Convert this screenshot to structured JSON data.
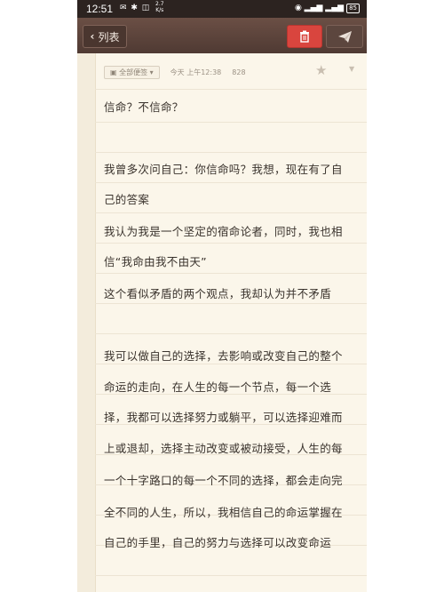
{
  "status": {
    "time": "12:51",
    "speed_top": "2.7",
    "speed_bottom": "K/s",
    "battery": "85"
  },
  "nav": {
    "back_label": "列表"
  },
  "meta": {
    "folder": "全部便签",
    "timestamp": "今天 上午12:38",
    "count": "828"
  },
  "lines": [
    "信命？不信命？",
    "",
    "我曾多次问自己：你信命吗？我想，现在有了自",
    "己的答案",
    "我认为我是一个坚定的宿命论者，同时，我也相",
    "信“我命由我不由天”",
    "这个看似矛盾的两个观点，我却认为并不矛盾",
    "",
    "我可以做自己的选择，去影响或改变自己的整个",
    "命运的走向，在人生的每一个节点，每一个选",
    "择，我都可以选择努力或躺平，可以选择迎难而",
    "上或退却，选择主动改变或被动接受，人生的每",
    "一个十字路口的每一个不同的选择，都会走向完",
    "全不同的人生，所以，我相信自己的命运掌握在",
    "自己的手里，自己的努力与选择可以改变命运"
  ]
}
